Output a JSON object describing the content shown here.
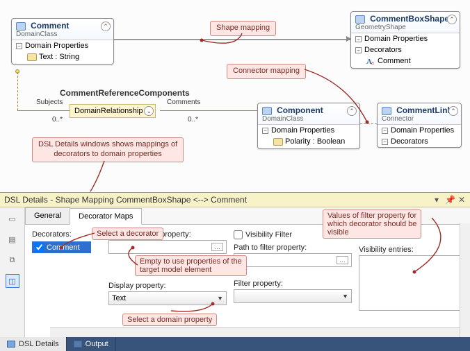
{
  "canvas": {
    "comment_node": {
      "title": "Comment",
      "subtitle": "DomainClass",
      "section": "Domain Properties",
      "prop": "Text : String"
    },
    "component_node": {
      "title": "Component",
      "subtitle": "DomainClass",
      "section": "Domain Properties",
      "prop": "Polarity : Boolean"
    },
    "shape_node": {
      "title": "CommentBoxShape",
      "subtitle": "GeometryShape",
      "sec1": "Domain Properties",
      "sec2": "Decorators",
      "dec": "Comment"
    },
    "link_node": {
      "title": "CommentLink",
      "subtitle": "Connector",
      "sec1": "Domain Properties",
      "sec2": "Decorators"
    },
    "relationship": {
      "name": "CommentReferenceComponents",
      "type": "DomainRelationship",
      "left_role": "Subjects",
      "left_mult": "0..*",
      "right_role": "Comments",
      "right_mult": "0..*"
    },
    "callouts": {
      "shape_mapping": "Shape mapping",
      "connector_mapping": "Connector mapping",
      "dsl_details": "DSL Details windows shows mappings of\ndecorators to domain properties"
    }
  },
  "details": {
    "title": "DSL Details - Shape Mapping CommentBoxShape <--> Comment",
    "tabs": {
      "general": "General",
      "maps": "Decorator Maps"
    },
    "decorators_label": "Decorators:",
    "decorator_item": "Comment",
    "path_display_label": "Path to display property:",
    "display_prop_label": "Display property:",
    "display_prop_value": "Text",
    "vis_filter_label": "Visibility Filter",
    "path_filter_label": "Path to filter property:",
    "filter_prop_label": "Filter property:",
    "vis_entries_label": "Visibility entries:",
    "callouts": {
      "select_decorator": "Select a decorator",
      "empty_path": "Empty to use properties of the\ntarget model element",
      "select_domain": "Select a domain property",
      "vis_values": "Values of filter property for\nwhich decorator should be\nvisible"
    }
  },
  "bottom": {
    "dsl": "DSL Details",
    "output": "Output"
  }
}
